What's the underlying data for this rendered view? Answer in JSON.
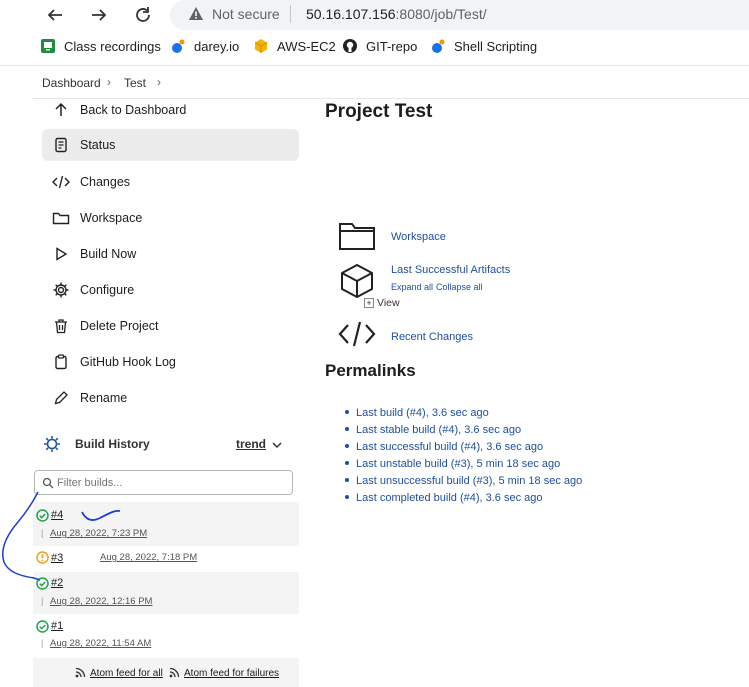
{
  "browser": {
    "security_label": "Not secure",
    "url_host": "50.16.107.156",
    "url_rest": ":8080/job/Test/",
    "bookmarks": [
      {
        "label": "Class recordings",
        "icon": "google-classroom-icon"
      },
      {
        "label": "darey.io",
        "icon": "darey-icon"
      },
      {
        "label": "AWS-EC2",
        "icon": "aws-cube-icon"
      },
      {
        "label": "GIT-repo",
        "icon": "github-icon"
      },
      {
        "label": "Shell Scripting",
        "icon": "darey-icon"
      }
    ]
  },
  "breadcrumb": {
    "items": [
      "Dashboard",
      "Test"
    ]
  },
  "sidebar": {
    "items": [
      {
        "label": "Back to Dashboard",
        "icon": "arrow-up-icon"
      },
      {
        "label": "Status",
        "icon": "document-icon"
      },
      {
        "label": "Changes",
        "icon": "code-icon"
      },
      {
        "label": "Workspace",
        "icon": "folder-icon"
      },
      {
        "label": "Build Now",
        "icon": "play-icon"
      },
      {
        "label": "Configure",
        "icon": "gear-icon"
      },
      {
        "label": "Delete Project",
        "icon": "trash-icon"
      },
      {
        "label": "GitHub Hook Log",
        "icon": "clipboard-icon"
      },
      {
        "label": "Rename",
        "icon": "pencil-icon"
      }
    ]
  },
  "build_history": {
    "title": "Build History",
    "trend_label": "trend",
    "filter_placeholder": "Filter builds...",
    "builds": [
      {
        "number": "#4",
        "date": "Aug 28, 2022, 7:23 PM",
        "status": "success"
      },
      {
        "number": "#3",
        "date": "Aug 28, 2022, 7:18 PM",
        "status": "unstable"
      },
      {
        "number": "#2",
        "date": "Aug 28, 2022, 12:16 PM",
        "status": "success"
      },
      {
        "number": "#1",
        "date": "Aug 28, 2022, 11:54 AM",
        "status": "success"
      }
    ],
    "feed_all": "Atom feed for all",
    "feed_failures": "Atom feed for failures"
  },
  "main": {
    "title": "Project Test",
    "workspace_link": "Workspace",
    "artifacts_link": "Last Successful Artifacts",
    "expand_all": "Expand all",
    "collapse_all": "Collapse all",
    "view_label": "View",
    "recent_changes_link": "Recent Changes",
    "permalinks_title": "Permalinks",
    "permalinks": [
      "Last build (#4), 3.6 sec ago",
      "Last stable build (#4), 3.6 sec ago",
      "Last successful build (#4), 3.6 sec ago",
      "Last unstable build (#3), 5 min 18 sec ago",
      "Last unsuccessful build (#3), 5 min 18 sec ago",
      "Last completed build (#4), 3.6 sec ago"
    ]
  },
  "colors": {
    "link": "#1f4fa0",
    "success": "#1ea64b",
    "unstable": "#f0a020",
    "annotation": "#1a3fd1"
  }
}
